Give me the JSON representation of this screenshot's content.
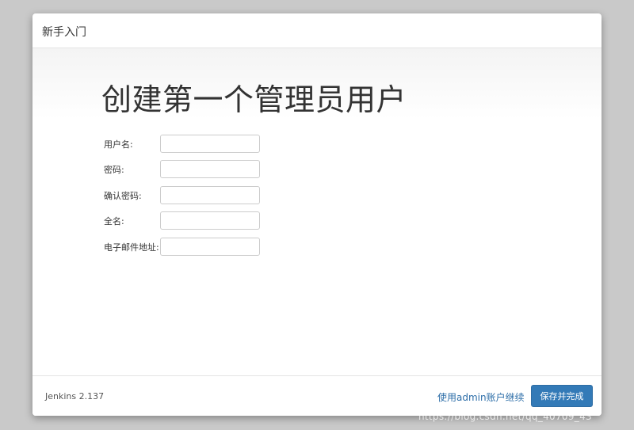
{
  "dialog": {
    "title": "新手入门",
    "heading": "创建第一个管理员用户"
  },
  "form": {
    "fields": [
      {
        "label": "用户名:",
        "value": "",
        "type": "text"
      },
      {
        "label": "密码:",
        "value": "",
        "type": "password"
      },
      {
        "label": "确认密码:",
        "value": "",
        "type": "password"
      },
      {
        "label": "全名:",
        "value": "",
        "type": "text"
      },
      {
        "label": "电子邮件地址:",
        "value": "",
        "type": "text"
      }
    ]
  },
  "footer": {
    "version": "Jenkins 2.137",
    "continue_link": "使用admin账户继续",
    "save_button": "保存并完成"
  },
  "watermark": "https://blog.csdn.net/qq_40709_43",
  "colors": {
    "primary": "#337ab7",
    "link": "#2d6ea8",
    "backdrop": "#c9c9c9"
  }
}
